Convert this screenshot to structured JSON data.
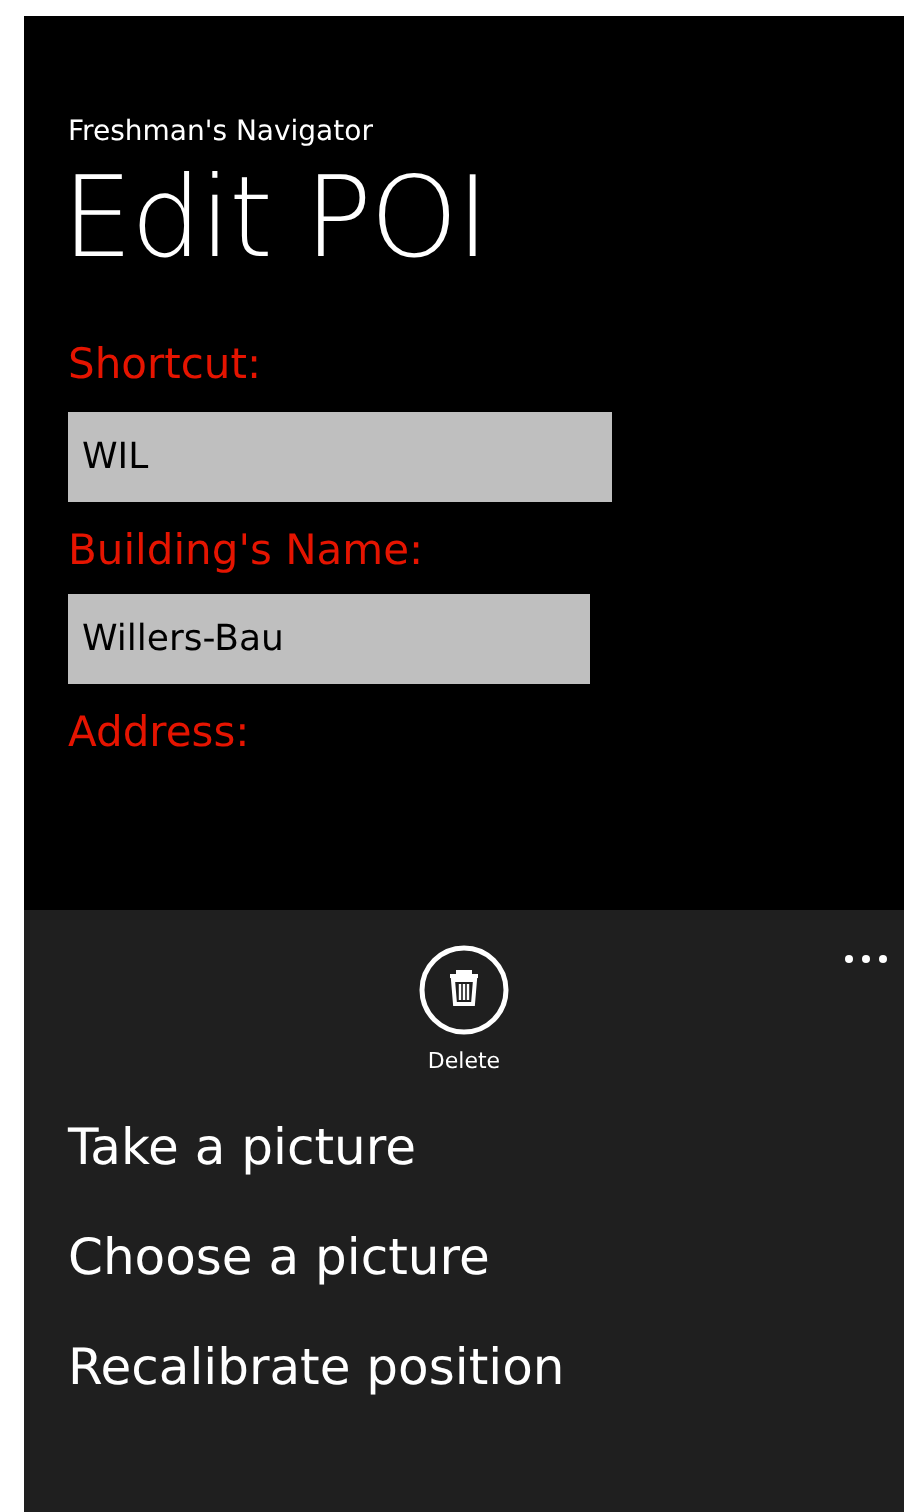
{
  "app_title": "Freshman's Navigator",
  "page_title": "Edit POI",
  "fields": [
    {
      "label": "Shortcut:",
      "value": "WIL"
    },
    {
      "label": "Building's Name:",
      "value": "Willers-Bau"
    }
  ],
  "next_label": "Address:",
  "app_bar": {
    "buttons": [
      {
        "label": "Delete",
        "kind": "delete"
      }
    ],
    "menu_items": [
      "Take a picture",
      "Choose a picture",
      "Recalibrate position"
    ]
  }
}
